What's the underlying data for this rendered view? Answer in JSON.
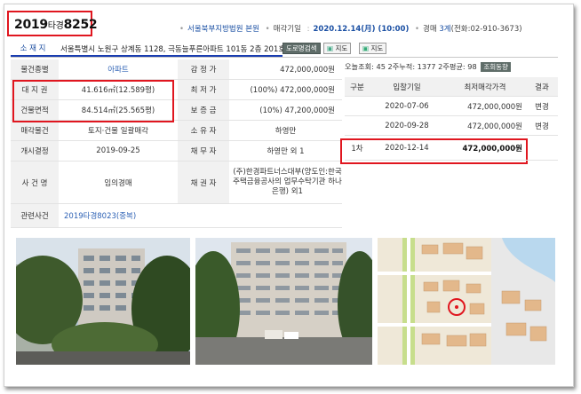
{
  "header": {
    "case_year": "2019",
    "case_type": "타경",
    "case_num": "8252",
    "court": "서울북부지방법원 본원",
    "sale_date_label": "매각기일",
    "sale_date": "2020.12.14(月) (10:00)",
    "dept_prefix": "경매",
    "dept_num": "3계",
    "phone": "(전화:02-910-3673)"
  },
  "address": {
    "label": "소 재 지",
    "text": "서울특별시 노원구 상계동 1128, 극동늘푸른아파트 101동 2층 201호",
    "btn_road": "도로명검색",
    "btn_map1": "지도",
    "btn_map2": "지도"
  },
  "left_table": {
    "type_label": "물건종별",
    "type_value": "아파트",
    "appraisal_label": "감 정 가",
    "appraisal_value": "472,000,000원",
    "land_label": "대 지 권",
    "land_value": "41.616㎡(12.589평)",
    "min_label": "최 저 가",
    "min_value": "(100%) 472,000,000원",
    "bldg_label": "건물면적",
    "bldg_value": "84.514㎡(25.565평)",
    "deposit_label": "보 증 금",
    "deposit_value": "(10%) 47,200,000원",
    "sale_obj_label": "매각물건",
    "sale_obj_value": "토지·건물 일괄매각",
    "owner_label": "소 유 자",
    "owner_value": "하영만",
    "start_label": "개시결정",
    "start_value": "2019-09-25",
    "debtor_label": "채 무 자",
    "debtor_value": "하영만 외 1",
    "case_name_label": "사 건 명",
    "case_name_value": "임의경매",
    "creditor_label": "채 권 자",
    "creditor_value": "(주)한경파트너스대부(양도인:한국주택금융공사의 업무수탁기관 하나은행) 외1",
    "related_label": "관련사건",
    "related_value": "2019타경8023(중복)"
  },
  "right_table": {
    "stats": "오늘조회: 45  2주누적: 1377  2주평균: 98",
    "stats_btn": "조회동향",
    "headers": [
      "구분",
      "입찰기일",
      "최저매각가격",
      "결과"
    ],
    "rows": [
      {
        "round": "",
        "date": "2020-07-06",
        "price": "472,000,000원",
        "result": "변경"
      },
      {
        "round": "",
        "date": "2020-09-28",
        "price": "472,000,000원",
        "result": "변경"
      },
      {
        "round": "1차",
        "date": "2020-12-14",
        "price": "472,000,000원",
        "result": ""
      }
    ]
  },
  "colors": {
    "highlight_red": "#e0161f",
    "link_blue": "#2e62b5",
    "label_blue": "#1d4fa1"
  }
}
